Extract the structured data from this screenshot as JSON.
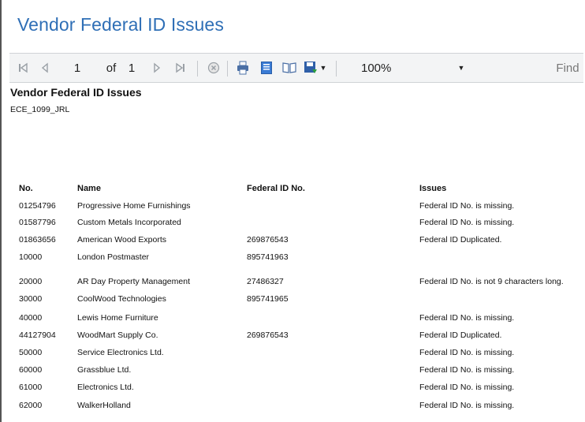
{
  "page": {
    "title": "Vendor Federal ID Issues"
  },
  "toolbar": {
    "current_page": "1",
    "of_label": "of",
    "total_pages": "1",
    "zoom": "100%",
    "find_label": "Find",
    "icons": [
      "first-page-icon",
      "previous-page-icon",
      "next-page-icon",
      "last-page-icon",
      "stop-icon",
      "print-icon",
      "print-layout-icon",
      "page-setup-icon",
      "export-icon",
      "zoom-dropdown-icon"
    ]
  },
  "report": {
    "title": "Vendor Federal ID Issues",
    "subtitle": "ECE_1099_JRL",
    "columns": {
      "no": "No.",
      "name": "Name",
      "federal_id": "Federal ID No.",
      "issues": "Issues"
    },
    "rows": [
      {
        "no": "01254796",
        "name": "Progressive Home Furnishings",
        "federal_id": "",
        "issues": "Federal ID No. is missing."
      },
      {
        "no": "01587796",
        "name": "Custom Metals Incorporated",
        "federal_id": "",
        "issues": "Federal ID No. is missing."
      },
      {
        "no": "01863656",
        "name": "American Wood Exports",
        "federal_id": "269876543",
        "issues": "Federal ID Duplicated."
      },
      {
        "no": "10000",
        "name": "London Postmaster",
        "federal_id": "895741963",
        "issues": ""
      },
      {
        "no": "20000",
        "name": "AR Day Property Management",
        "federal_id": "27486327",
        "issues": "Federal ID No. is not 9 characters long."
      },
      {
        "no": "30000",
        "name": "CoolWood Technologies",
        "federal_id": "895741965",
        "issues": ""
      },
      {
        "no": "40000",
        "name": "Lewis Home Furniture",
        "federal_id": "",
        "issues": "Federal ID No. is missing."
      },
      {
        "no": "44127904",
        "name": "WoodMart Supply Co.",
        "federal_id": "269876543",
        "issues": "Federal ID Duplicated."
      },
      {
        "no": "50000",
        "name": "Service Electronics Ltd.",
        "federal_id": "",
        "issues": "Federal ID No. is missing."
      },
      {
        "no": "60000",
        "name": "Grassblue Ltd.",
        "federal_id": "",
        "issues": "Federal ID No. is missing."
      },
      {
        "no": "61000",
        "name": "Electronics Ltd.",
        "federal_id": "",
        "issues": "Federal ID No. is missing."
      },
      {
        "no": "62000",
        "name": "WalkerHolland",
        "federal_id": "",
        "issues": "Federal ID No. is missing."
      }
    ]
  },
  "colors": {
    "title_blue": "#2f6fb6",
    "toolbar_bg": "#f3f4f5"
  }
}
